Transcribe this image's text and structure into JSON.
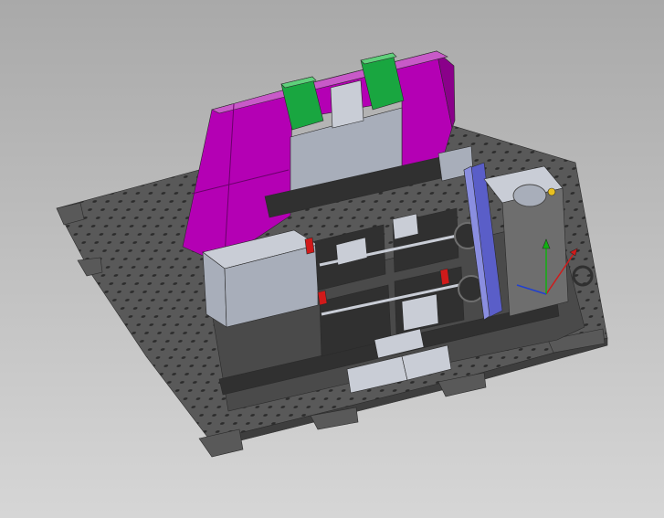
{
  "viewport": {
    "background_top": "#a9a9a9",
    "background_bottom": "#d6d6d6"
  },
  "model": {
    "colors": {
      "base_plate": "#595959",
      "base_plate_edge": "#3e3e3e",
      "plate_hole": "#2c2c2c",
      "enclosure_front": "#b400b4",
      "enclosure_side": "#8a008a",
      "enclosure_top": "#c85ac8",
      "panel_green": "#19a640",
      "panel_green_top": "#5fd07b",
      "sheet_metal": "#a8aeba",
      "sheet_metal_light": "#c9cdd6",
      "frame_dark": "#4a4a4a",
      "mechanism": "#303030",
      "motor_blue": "#5a5ec8",
      "motor_blue_light": "#8a8ee0",
      "spindle_housing": "#6e6e6e",
      "accent_red": "#d01a1a",
      "accent_yellow": "#e8c020"
    }
  },
  "triad": {
    "x_color": "#d01a1a",
    "y_color": "#10b010",
    "z_color": "#2040d0"
  }
}
